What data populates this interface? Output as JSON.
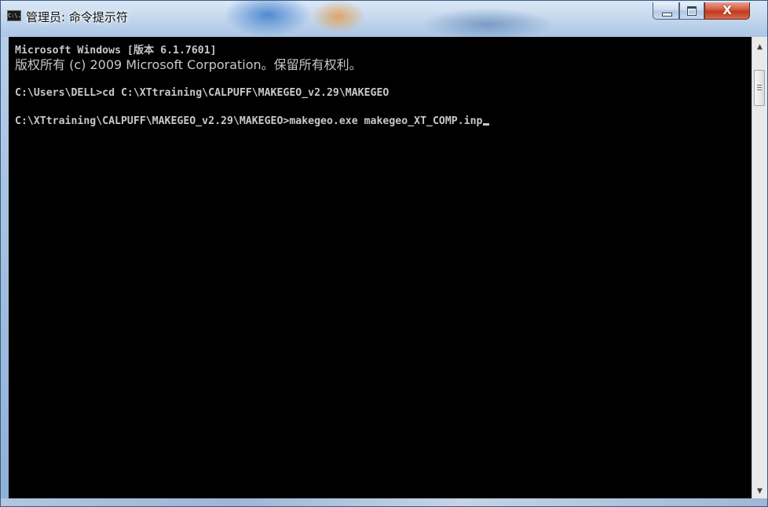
{
  "window": {
    "title": "管理员: 命令提示符",
    "icon": "cmd-icon",
    "icon_text": "C:\\.",
    "controls": {
      "minimize": "minimize-icon",
      "maximize": "maximize-icon",
      "close": "close-icon",
      "close_glyph": "X"
    }
  },
  "console": {
    "lines": [
      "Microsoft Windows [版本 6.1.7601]",
      "版权所有 (c) 2009 Microsoft Corporation。保留所有权利。",
      "",
      "C:\\Users\\DELL>cd C:\\XTtraining\\CALPUFF\\MAKEGEO_v2.29\\MAKEGEO",
      "",
      "C:\\XTtraining\\CALPUFF\\MAKEGEO_v2.29\\MAKEGEO>makegeo.exe makegeo_XT_COMP.inp"
    ],
    "text_color": "#c8c8c8",
    "background": "#000000"
  },
  "scrollbar": {
    "up_arrow": "▲",
    "down_arrow": "▼"
  }
}
